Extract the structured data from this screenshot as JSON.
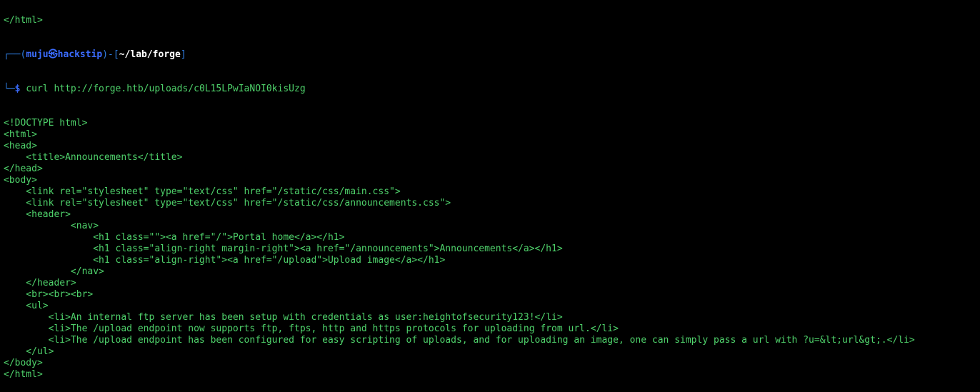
{
  "prompt": {
    "prev_line": "</html>",
    "frame_top_left": "┌──(",
    "user": "muju㉿hackstip",
    "frame_mid": ")-[",
    "path": "~/lab/forge",
    "frame_close": "]",
    "frame_bottom": "└─",
    "dollar": "$",
    "command": " curl http://forge.htb/uploads/c0L15LPwIaNOI0kisUzg"
  },
  "output_lines": [
    "<!DOCTYPE html>",
    "<html>",
    "<head>",
    "    <title>Announcements</title>",
    "</head>",
    "<body>",
    "    <link rel=\"stylesheet\" type=\"text/css\" href=\"/static/css/main.css\">",
    "    <link rel=\"stylesheet\" type=\"text/css\" href=\"/static/css/announcements.css\">",
    "    <header>",
    "            <nav>",
    "                <h1 class=\"\"><a href=\"/\">Portal home</a></h1>",
    "                <h1 class=\"align-right margin-right\"><a href=\"/announcements\">Announcements</a></h1>",
    "                <h1 class=\"align-right\"><a href=\"/upload\">Upload image</a></h1>",
    "            </nav>",
    "    </header>",
    "    <br><br><br>",
    "    <ul>",
    "        <li>An internal ftp server has been setup with credentials as user:heightofsecurity123!</li>",
    "        <li>The /upload endpoint now supports ftp, ftps, http and https protocols for uploading from url.</li>",
    "        <li>The /upload endpoint has been configured for easy scripting of uploads, and for uploading an image, one can simply pass a url with ?u=&lt;url&gt;.</li>",
    "    </ul>",
    "</body>",
    "</html>"
  ],
  "colors": {
    "background": "#000000",
    "text_green": "#4fd26b",
    "prompt_blue": "#3b6cff",
    "path_white": "#ffffff"
  }
}
